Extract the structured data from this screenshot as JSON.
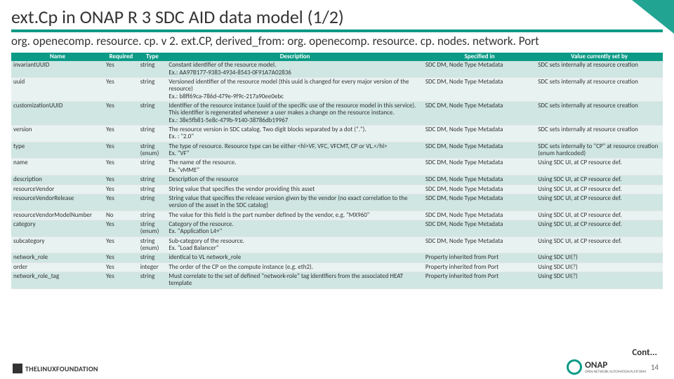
{
  "title": "ext.Cp in ONAP R 3 SDC AID data model (1/2)",
  "subtitle": "org. openecomp. resource. cp. v 2. ext.CP, derived_from: org. openecomp. resource. cp. nodes. network. Port",
  "headers": [
    "Name",
    "Required",
    "Type",
    "Description",
    "Specified in",
    "Value currently set by"
  ],
  "rows": [
    {
      "name": "invariantUUID",
      "req": "Yes",
      "type": "string",
      "desc": "Constant identifier of the resource model.\nEx.: AA97B177-9383-4934-8543-0F91A7A02836",
      "spec": "SDC DM, Node Type Metadata",
      "val": "SDC sets internally at resource creation"
    },
    {
      "name": "uuid",
      "req": "Yes",
      "type": "string",
      "desc": "Versioned identifier of the resource model (this uuid is changed for every major version of the resource)\nEx.: b8ff69ca-786d-479e-9f9c-217a90ee0ebc",
      "spec": "SDC DM, Node Type Metadata",
      "val": "SDC sets internally at resource creation"
    },
    {
      "name": "customizationUUID",
      "req": "Yes",
      "type": "string",
      "desc": "Identifier of the resource instance (uuid of the specific use of the resource model in this service). This identifier is regenerated whenever a user makes a change on the resource instance.\nEx.: 38e5fb81-5e8c-479b-9140-38786db19967",
      "spec": "SDC DM, Node Type Metadata",
      "val": "SDC sets internally at resource creation"
    },
    {
      "name": "version",
      "req": "Yes",
      "type": "string",
      "desc": "The resource version in SDC catalog. Two digit blocks separated by a dot (\".\").\nEx. : \"2.0\"",
      "spec": "SDC DM, Node Type Metadata",
      "val": "SDC sets internally at resource creation"
    },
    {
      "name": "type",
      "req": "Yes",
      "type": "string (enum)",
      "desc": "The type of resource. Resource type can be either <hl>VF, VFC, VFCMT, CP or VL.</hl>\nEx. \"VF\"",
      "spec": "SDC DM, Node Type Metadata",
      "val": "SDC sets internally to \"CP\" at resource creation (enum hardcoded)"
    },
    {
      "name": "name",
      "req": "Yes",
      "type": "string",
      "desc": "The name of the resource.\nEx. \"vMME\"",
      "spec": "SDC DM, Node Type Metadata",
      "val": "Using SDC UI, at CP resource def."
    },
    {
      "name": "description",
      "req": "Yes",
      "type": "string",
      "desc": "Description of the resource",
      "spec": "SDC DM, Node Type Metadata",
      "val": "Using SDC UI, at CP resource def."
    },
    {
      "name": "resourceVendor",
      "req": "Yes",
      "type": "string",
      "desc": "String value that specifies the vendor providing this asset",
      "spec": "SDC DM, Node Type Metadata",
      "val": "Using SDC UI, at CP resource def."
    },
    {
      "name": "resourceVendorRelease",
      "req": "Yes",
      "type": "string",
      "desc": "String value that specifies the release version given by the vendor (no exact correlation to the version of the asset in the SDC catalog)",
      "spec": "SDC DM, Node Type Metadata",
      "val": "Using SDC UI, at CP resource def."
    },
    {
      "name": "resourceVendorModelNumber",
      "req": "No",
      "type": "string",
      "desc": "The value for this field is the part number defined by the vendor, e.g. \"MX960\"",
      "spec": "SDC DM, Node Type Metadata",
      "val": "Using SDC UI, at CP resource def."
    },
    {
      "name": "category",
      "req": "Yes",
      "type": "string (enum)",
      "desc": "Category of the resource.\nEx. \"Application L4+\"",
      "spec": "SDC DM, Node Type Metadata",
      "val": "Using SDC UI, at CP resource def."
    },
    {
      "name": "subcategory",
      "req": "Yes",
      "type": "string (enum)",
      "desc": "Sub-category of the resource.\nEx. \"Load Balancer\"",
      "spec": "SDC DM, Node Type Metadata",
      "val": "Using SDC UI, at CP resource def."
    },
    {
      "name": "network_role",
      "req": "Yes",
      "type": "string",
      "desc": "identical to VL network_role",
      "spec": "Property inherited from Port",
      "val": "Using SDC UI(?)"
    },
    {
      "name": "order",
      "req": "Yes",
      "type": "integer",
      "desc": "The order of the CP on the compute instance (e.g. eth2).",
      "spec": "Property inherited from Port",
      "val": "Using SDC UI(?)"
    },
    {
      "name": "network_role_tag",
      "req": "Yes",
      "type": "string",
      "desc": "Must correlate to the set of defined \"network-role\" tag identifiers from the associated HEAT template",
      "spec": "Property inherited from Port",
      "val": "Using SDC UI(?)"
    }
  ],
  "cont": "Cont...",
  "pagenum": "14",
  "footer_brand": "THELINUXFOUNDATION",
  "onap_name": "ONAP",
  "onap_sub": "OPEN NETWORK AUTOMATION PLATFORM"
}
